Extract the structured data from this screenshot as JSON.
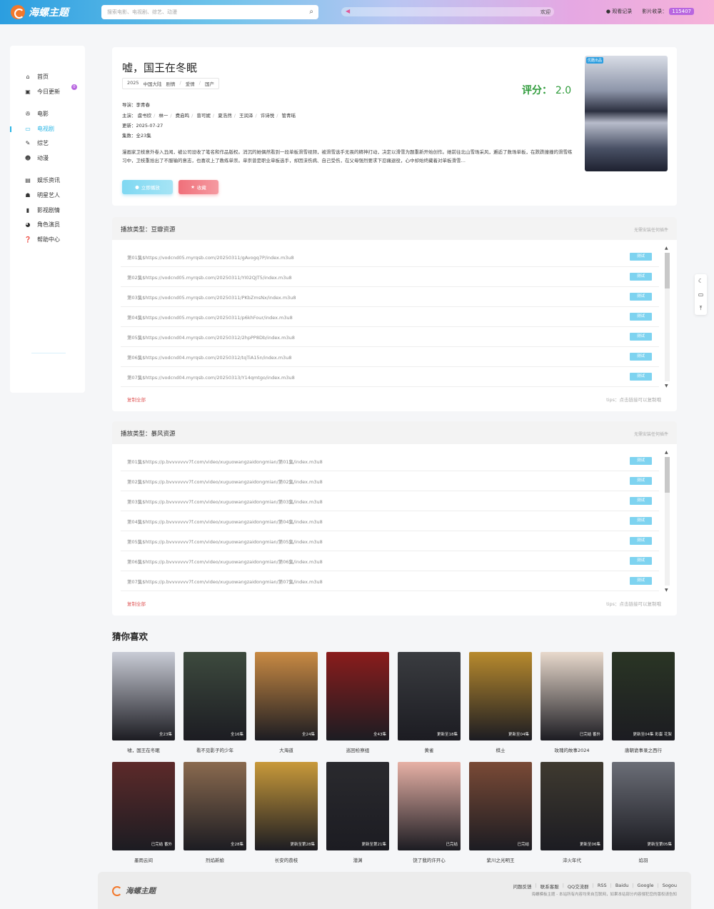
{
  "header": {
    "logo": "海螺主题",
    "search_placeholder": "搜索电影、电视剧、综艺、动漫",
    "notice": "欢迎",
    "history": "观看记录",
    "collect_label": "影片收录：",
    "collect_count": "115407"
  },
  "sidebar": {
    "items": [
      {
        "label": "首页",
        "icon": "home-icon"
      },
      {
        "label": "今日更新",
        "icon": "calendar-icon",
        "badge": "0"
      },
      {
        "label": "电影",
        "icon": "film-icon"
      },
      {
        "label": "电视剧",
        "icon": "tv-icon"
      },
      {
        "label": "综艺",
        "icon": "mic-icon"
      },
      {
        "label": "动漫",
        "icon": "cat-icon"
      },
      {
        "label": "娱乐资讯",
        "icon": "news-icon"
      },
      {
        "label": "明星艺人",
        "icon": "user-icon"
      },
      {
        "label": "影视剧情",
        "icon": "book-icon"
      },
      {
        "label": "角色演员",
        "icon": "mask-icon"
      },
      {
        "label": "帮助中心",
        "icon": "help-icon"
      }
    ]
  },
  "detail": {
    "title": "嘘，国王在冬眠",
    "tags": [
      "2025",
      "中国大陆",
      "剧情",
      "爱情",
      "国产"
    ],
    "score_label": "评分：",
    "score": "2.0",
    "director_label": "导演：",
    "director": "李青春",
    "cast_label": "主演：",
    "cast": [
      "虞书欣",
      "林一",
      "费启鸣",
      "曾可妮",
      "夏浩然",
      "王润泽",
      "许诗悦",
      "管青瑶"
    ],
    "update_label": "更新：",
    "update": "2025-07-27",
    "episodes_label": "集数：",
    "episodes": "全23集",
    "description": "漫画家卫枝意外卷入丑闻，被公司设收了笔名和作品版权。消沉的她偶然看到一段单板滑雪视频，被滑雪选手无畏的精神打动，决定以滑雪为题重新开始创作。她前往北山雪场采风，邂逅了数场单板，在跌跌撞撞的滑雪练习中，卫枝重拾出了不服输的意志，也喜欢上了教练单崇。单崇曾是职业单板选手，却因沫伤病、自己受伤，在父母强烈要求下忍痛退役，心中却始终藏着对单板滑雪…",
    "play_button": "立即播放",
    "fav_button": "收藏",
    "poster_tag": "优酷出品"
  },
  "sources": [
    {
      "title": "播放类型：豆瓣资源",
      "hint": "无需安装任何插件",
      "copy_all": "复制全部",
      "tips": "tips：点击链接可以复制哦",
      "test_label": "测试",
      "episodes": [
        "第01集$https://vodcnd05.myrqsb.com/20250311/gAvogq7P/index.m3u8",
        "第02集$https://vodcnd05.myrqsb.com/20250311/YI02QJT5/index.m3u8",
        "第03集$https://vodcnd05.myrqsb.com/20250311/PKbZmsNx/index.m3u8",
        "第04集$https://vodcnd05.myrqsb.com/20250311/p6khFour/index.m3u8",
        "第05集$https://vodcnd04.myrqsb.com/20250312/2hpPP8Db/index.m3u8",
        "第06集$https://vodcnd04.myrqsb.com/20250312/tqTiA15n/index.m3u8",
        "第07集$https://vodcnd04.myrqsb.com/20250313/Y14qmtgo/index.m3u8"
      ]
    },
    {
      "title": "播放类型：暴风资源",
      "hint": "无需安装任何插件",
      "copy_all": "复制全部",
      "tips": "tips：点击链接可以复制哦",
      "test_label": "测试",
      "episodes": [
        "第01集$https://p.bvvvvvvv7f.com/video/xuguowangzaidongmian/第01集/index.m3u8",
        "第02集$https://p.bvvvvvvv7f.com/video/xuguowangzaidongmian/第02集/index.m3u8",
        "第03集$https://p.bvvvvvvv7f.com/video/xuguowangzaidongmian/第03集/index.m3u8",
        "第04集$https://p.bvvvvvvv7f.com/video/xuguowangzaidongmian/第04集/index.m3u8",
        "第05集$https://p.bvvvvvvv7f.com/video/xuguowangzaidongmian/第05集/index.m3u8",
        "第06集$https://p.bvvvvvvv7f.com/video/xuguowangzaidongmian/第06集/index.m3u8",
        "第07集$https://p.bvvvvvvv7f.com/video/xuguowangzaidongmian/第07集/index.m3u8"
      ]
    }
  ],
  "recommend": {
    "title": "猜你喜欢",
    "items": [
      {
        "name": "嘘，国王在冬眠",
        "status": "全23集",
        "color": "#c9ccd6"
      },
      {
        "name": "看不见影子的少年",
        "status": "全16集",
        "color": "#3d4a3e"
      },
      {
        "name": "大海道",
        "status": "全24集",
        "color": "#c98a43"
      },
      {
        "name": "巡回检察组",
        "status": "全43集",
        "color": "#8a1c1c"
      },
      {
        "name": "黄雀",
        "status": "更新至18集",
        "color": "#3a3c40"
      },
      {
        "name": "棋士",
        "status": "更新至04集",
        "color": "#b88a2d"
      },
      {
        "name": "玫瑰的故事2024",
        "status": "已完结 番外",
        "color": "#e8d9cc"
      },
      {
        "name": "唐朝诡事录之西行",
        "status": "更新至04集 彩蛋 花絮",
        "color": "#2a3524"
      },
      {
        "name": "墨雨云间",
        "status": "已完结 番外",
        "color": "#5d2a2a"
      },
      {
        "name": "烈焰新娘",
        "status": "全28集",
        "color": "#8a6a4f"
      },
      {
        "name": "长安的荔枝",
        "status": "更新至第28集",
        "color": "#c99a3a"
      },
      {
        "name": "潜渊",
        "status": "更新至第21集",
        "color": "#2a2a2e"
      },
      {
        "name": "饶了我的许开心",
        "status": "已完结",
        "color": "#e7b1a6"
      },
      {
        "name": "紫川之光明王",
        "status": "已完结",
        "color": "#7a4a36"
      },
      {
        "name": "淬火年代",
        "status": "更新至06集",
        "color": "#3f3a30"
      },
      {
        "name": "焰羽",
        "status": "更新至第05集",
        "color": "#6b6e77"
      }
    ]
  },
  "footer": {
    "logo": "海螺主题",
    "links": [
      "问题反馈",
      "联系客服",
      "QQ交流群",
      "RSS",
      "Baidu",
      "Google",
      "Sogou"
    ],
    "copyright": "海螺模板主题 - 本站所有内容均来自互联网，如果本站部分内容侵犯您的版权请告知"
  }
}
